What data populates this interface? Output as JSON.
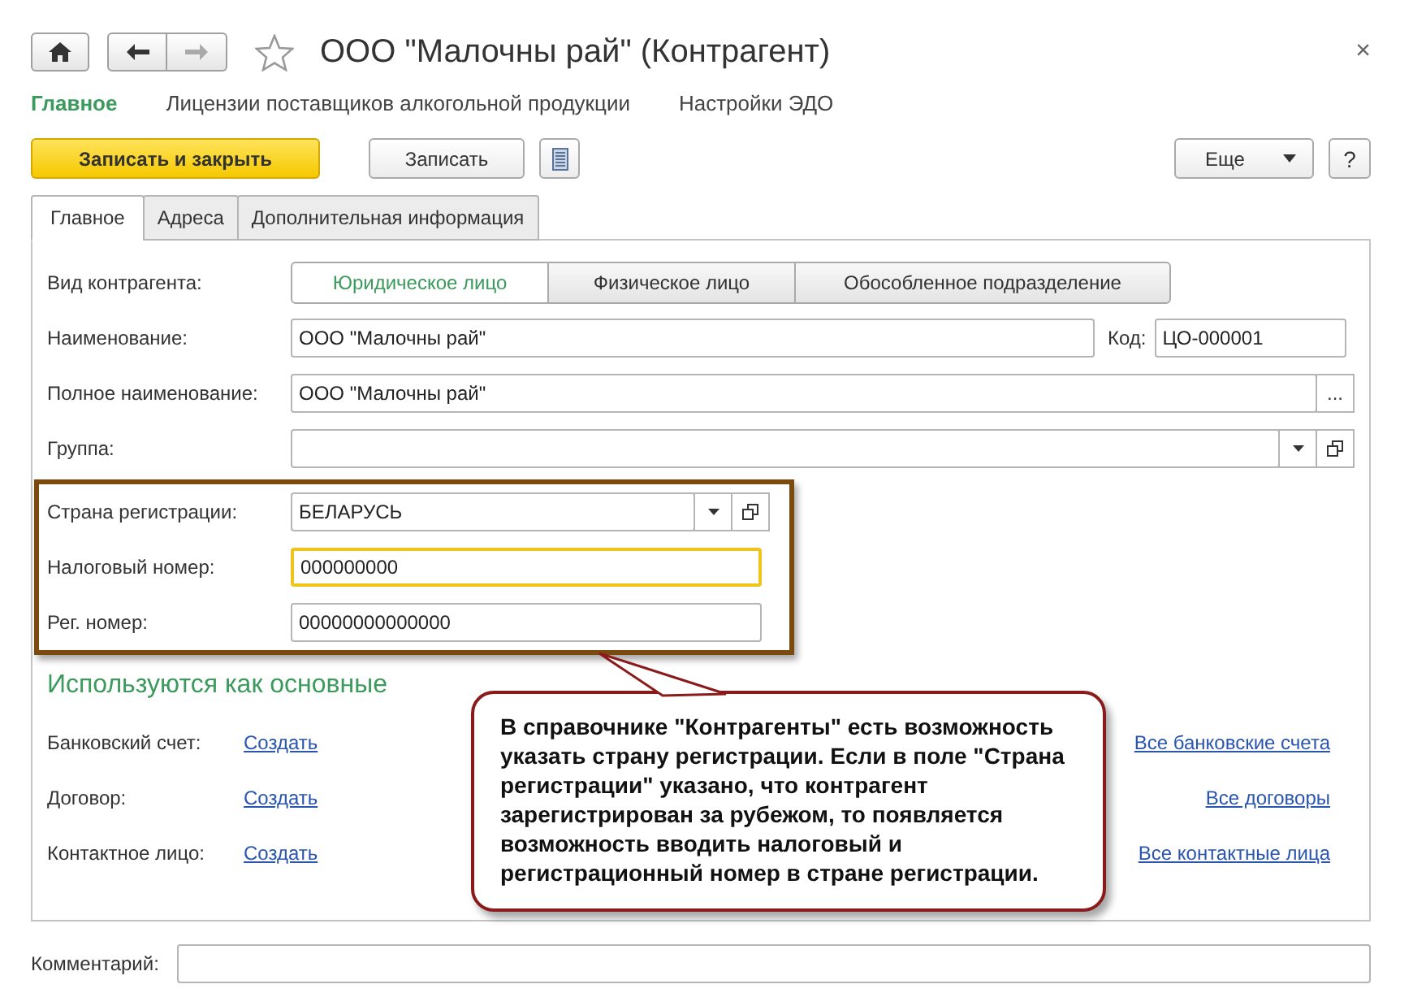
{
  "window": {
    "title": "ООО \"Малочны рай\" (Контрагент)",
    "close": "×",
    "favorite": false
  },
  "nav_links": [
    {
      "label": "Главное",
      "selected": true
    },
    {
      "label": "Лицензии поставщиков алкогольной продукции",
      "selected": false
    },
    {
      "label": "Настройки ЭДО",
      "selected": false
    }
  ],
  "toolbar": {
    "primary_button": "Записать и закрыть",
    "save_button": "Записать",
    "more_button": "Еще",
    "help_button": "?"
  },
  "tabs": [
    {
      "label": "Главное",
      "selected": true
    },
    {
      "label": "Адреса",
      "selected": false
    },
    {
      "label": "Дополнительная информация",
      "selected": false
    }
  ],
  "form": {
    "kind_label": "Вид контрагента:",
    "kind_options": [
      {
        "label": "Юридическое лицо",
        "selected": true
      },
      {
        "label": "Физическое лицо",
        "selected": false
      },
      {
        "label": "Обособленное подразделение",
        "selected": false
      }
    ],
    "name_label": "Наименование:",
    "name_value": "ООО \"Малочны рай\"",
    "code_label": "Код:",
    "code_value": "ЦО-000001",
    "full_name_label": "Полное наименование:",
    "full_name_value": "ООО \"Малочны рай\"",
    "full_name_button": "...",
    "group_label": "Группа:",
    "country_label": "Страна регистрации:",
    "country_value": "БЕЛАРУСЬ",
    "tax_label": "Налоговый номер:",
    "tax_value": "000000000",
    "tax_focused": true,
    "reg_label": "Рег. номер:",
    "reg_value": "00000000000000"
  },
  "defaults": {
    "title": "Используются как основные",
    "rows": [
      {
        "label": "Банковский счет:",
        "link": "Создать",
        "all_link": "Все банковские счета"
      },
      {
        "label": "Договор:",
        "link": "Создать",
        "all_link": "Все договоры"
      },
      {
        "label": "Контактное лицо:",
        "link": "Создать",
        "all_link": "Все контактные лица"
      }
    ]
  },
  "comment": {
    "label": "Комментарий:"
  },
  "callout": {
    "text": "В справочнике \"Контрагенты\" есть возможность указать страну регистрации. Если в поле \"Страна регистрации\" указано, что контрагент зарегистрирован за рубежом, то появляется возможность вводить налоговый и регистрационный номер в стране регистрации."
  }
}
